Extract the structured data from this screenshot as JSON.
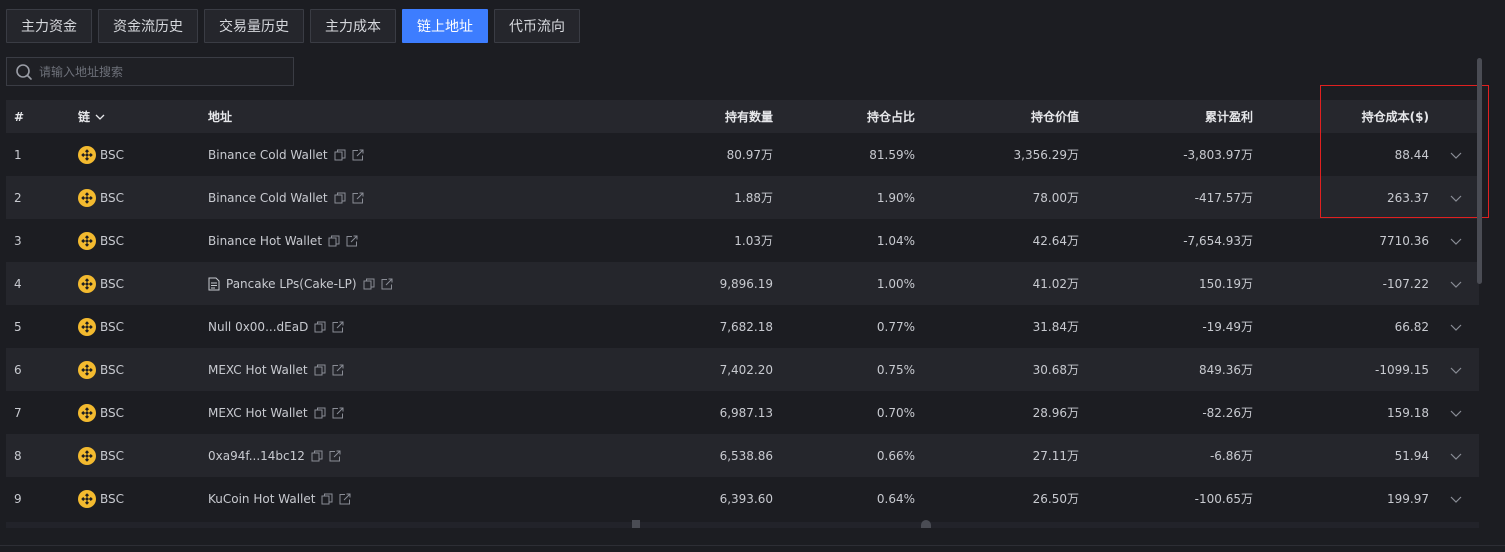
{
  "tabs": [
    {
      "label": "主力资金",
      "active": false
    },
    {
      "label": "资金流历史",
      "active": false
    },
    {
      "label": "交易量历史",
      "active": false
    },
    {
      "label": "主力成本",
      "active": false
    },
    {
      "label": "链上地址",
      "active": true
    },
    {
      "label": "代币流向",
      "active": false
    }
  ],
  "search": {
    "placeholder": "请输入地址搜索",
    "value": ""
  },
  "table": {
    "headers": {
      "index": "#",
      "chain": "链",
      "address": "地址",
      "quantity": "持有数量",
      "percent": "持仓占比",
      "value": "持仓价值",
      "pnl": "累计盈利",
      "cost": "持仓成本($)"
    },
    "rows": [
      {
        "index": "1",
        "chain": "BSC",
        "address": "Binance Cold Wallet",
        "contract": false,
        "quantity": "80.97万",
        "percent": "81.59%",
        "value": "3,356.29万",
        "pnl": "-3,803.97万",
        "cost": "88.44"
      },
      {
        "index": "2",
        "chain": "BSC",
        "address": "Binance Cold Wallet",
        "contract": false,
        "quantity": "1.88万",
        "percent": "1.90%",
        "value": "78.00万",
        "pnl": "-417.57万",
        "cost": "263.37"
      },
      {
        "index": "3",
        "chain": "BSC",
        "address": "Binance Hot Wallet",
        "contract": false,
        "quantity": "1.03万",
        "percent": "1.04%",
        "value": "42.64万",
        "pnl": "-7,654.93万",
        "cost": "7710.36"
      },
      {
        "index": "4",
        "chain": "BSC",
        "address": "Pancake LPs(Cake-LP)",
        "contract": true,
        "quantity": "9,896.19",
        "percent": "1.00%",
        "value": "41.02万",
        "pnl": "150.19万",
        "cost": "-107.22"
      },
      {
        "index": "5",
        "chain": "BSC",
        "address": "Null 0x00...dEaD",
        "contract": false,
        "quantity": "7,682.18",
        "percent": "0.77%",
        "value": "31.84万",
        "pnl": "-19.49万",
        "cost": "66.82"
      },
      {
        "index": "6",
        "chain": "BSC",
        "address": "MEXC Hot Wallet",
        "contract": false,
        "quantity": "7,402.20",
        "percent": "0.75%",
        "value": "30.68万",
        "pnl": "849.36万",
        "cost": "-1099.15"
      },
      {
        "index": "7",
        "chain": "BSC",
        "address": "MEXC Hot Wallet",
        "contract": false,
        "quantity": "6,987.13",
        "percent": "0.70%",
        "value": "28.96万",
        "pnl": "-82.26万",
        "cost": "159.18"
      },
      {
        "index": "8",
        "chain": "BSC",
        "address": "0xa94f...14bc12",
        "contract": false,
        "quantity": "6,538.86",
        "percent": "0.66%",
        "value": "27.11万",
        "pnl": "-6.86万",
        "cost": "51.94"
      },
      {
        "index": "9",
        "chain": "BSC",
        "address": "KuCoin Hot Wallet",
        "contract": false,
        "quantity": "6,393.60",
        "percent": "0.64%",
        "value": "26.50万",
        "pnl": "-100.65万",
        "cost": "199.97"
      }
    ]
  },
  "icons": {
    "search": "search-icon",
    "chain_logo": "bnb-chain-icon",
    "copy": "copy-icon",
    "external_link": "external-link-icon",
    "contract": "document-icon",
    "expand": "chevron-down-icon"
  },
  "colors": {
    "accent": "#3d7dff",
    "highlight_box": "#e02020",
    "bnb": "#f3ba2f",
    "background": "#1c1d22"
  }
}
